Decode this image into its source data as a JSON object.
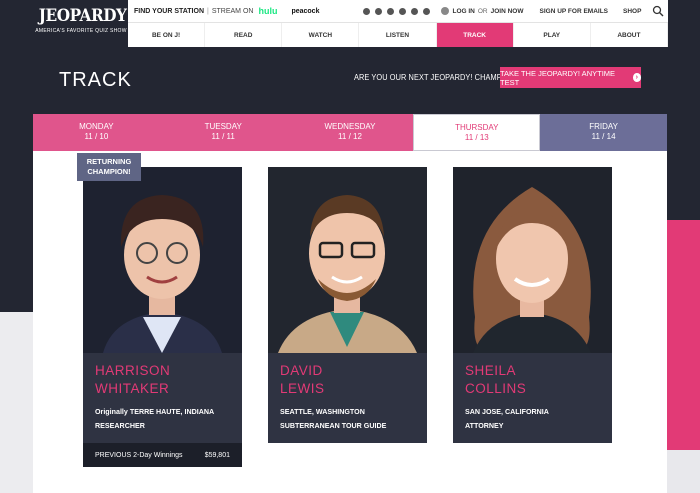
{
  "brand": {
    "logo_text": "JEOPARDY!",
    "tagline": "AMERICA'S FAVORITE QUIZ SHOW",
    "accent": "#e23a76",
    "dark": "#232632"
  },
  "header": {
    "find_station": "FIND YOUR STATION",
    "stream_on": "STREAM ON",
    "hulu": "hulu",
    "peacock": "peacock",
    "login": "LOG IN",
    "or": "OR",
    "join": "JOIN NOW",
    "signup": "SIGN UP FOR EMAILS",
    "shop": "SHOP",
    "socials": [
      "facebook-icon",
      "x-icon",
      "instagram-icon",
      "youtube-icon",
      "tiktok-icon",
      "store-icon"
    ]
  },
  "nav": [
    {
      "label": "BE ON J!"
    },
    {
      "label": "READ"
    },
    {
      "label": "WATCH"
    },
    {
      "label": "LISTEN"
    },
    {
      "label": "TRACK",
      "active": true
    },
    {
      "label": "PLAY"
    },
    {
      "label": "ABOUT"
    }
  ],
  "page": {
    "title": "TRACK",
    "promo_text": "ARE YOU OUR NEXT JEOPARDY! CHAMPION?",
    "promo_button": "TAKE THE JEOPARDY! ANYTIME TEST"
  },
  "days": [
    {
      "day": "MONDAY",
      "date": "11 / 10"
    },
    {
      "day": "TUESDAY",
      "date": "11 / 11"
    },
    {
      "day": "WEDNESDAY",
      "date": "11 / 12"
    },
    {
      "day": "THURSDAY",
      "date": "11 / 13",
      "active": true
    },
    {
      "day": "FRIDAY",
      "date": "11 / 14"
    }
  ],
  "contestants": [
    {
      "first": "HARRISON",
      "last": "WHITAKER",
      "hometown": "Originally TERRE HAUTE, INDIANA",
      "occupation": "RESEARCHER",
      "badge": "RETURNING CHAMPION!",
      "winnings_label": "PREVIOUS 2-Day Winnings",
      "winnings_value": "$59,801"
    },
    {
      "first": "DAVID",
      "last": "LEWIS",
      "hometown": "SEATTLE, WASHINGTON",
      "occupation": "SUBTERRANEAN TOUR GUIDE"
    },
    {
      "first": "SHEILA",
      "last": "COLLINS",
      "hometown": "SAN JOSE, CALIFORNIA",
      "occupation": "ATTORNEY"
    }
  ]
}
